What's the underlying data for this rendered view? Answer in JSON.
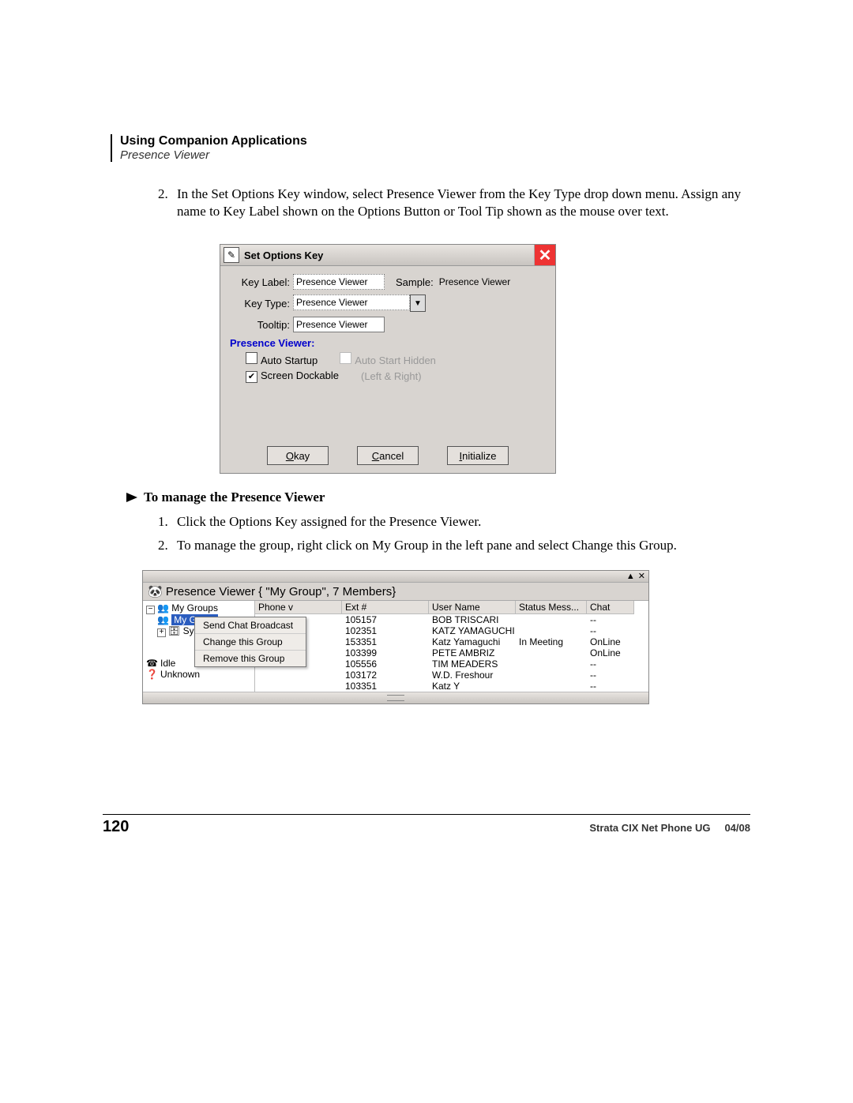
{
  "header": {
    "chapter": "Using Companion Applications",
    "section": "Presence Viewer"
  },
  "intro_step": {
    "num": "2.",
    "text": "In the Set Options Key window, select Presence Viewer from the Key Type drop down menu. Assign any name to Key Label shown on the Options Button or Tool Tip shown as the mouse over text."
  },
  "dialog": {
    "title": "Set Options Key",
    "labels": {
      "key_label": "Key Label:",
      "key_type": "Key Type:",
      "tooltip": "Tooltip:",
      "sample": "Sample:"
    },
    "values": {
      "key_label": "Presence Viewer",
      "key_type": "Presence Viewer",
      "tooltip": "Presence Viewer",
      "sample": "Presence Viewer"
    },
    "section": "Presence Viewer:",
    "checks": {
      "auto_startup": "Auto Startup",
      "auto_start_hidden": "Auto Start Hidden",
      "screen_dockable": "Screen Dockable",
      "screen_dockable_hint": "(Left & Right)"
    },
    "buttons": {
      "ok": "Okay",
      "ok_ul": "O",
      "cancel": "Cancel",
      "cancel_ul": "C",
      "init": "Initialize",
      "init_ul": "I"
    }
  },
  "task": {
    "heading": "To manage the Presence Viewer",
    "steps": [
      {
        "num": "1.",
        "text": "Click the Options Key assigned for the Presence Viewer."
      },
      {
        "num": "2.",
        "text": "To manage the group, right click on My Group in the left pane and select Change this Group."
      }
    ]
  },
  "pv": {
    "title_prefix": "Presence Viewer  ",
    "title_group": "{ \"My Group\", 7 Members}",
    "tree": {
      "root": "My Groups",
      "sel": "My Group",
      "sys": "System"
    },
    "context": [
      "Send Chat Broadcast",
      "Change this Group",
      "Remove this Group"
    ],
    "status_items": [
      "Idle",
      "Unknown"
    ],
    "columns": [
      "Phone  v",
      "Ext #",
      "User Name",
      "Status Mess...",
      "Chat"
    ],
    "rows": [
      {
        "ext": "105157",
        "user": "BOB TRISCARI",
        "status": "",
        "chat": "--"
      },
      {
        "ext": "102351",
        "user": "KATZ YAMAGUCHI",
        "status": "",
        "chat": "--"
      },
      {
        "ext": "153351",
        "user": "Katz Yamaguchi",
        "status": "In Meeting",
        "chat": "OnLine"
      },
      {
        "ext": "103399",
        "user": "PETE AMBRIZ",
        "status": "",
        "chat": "OnLine"
      },
      {
        "ext": "105556",
        "user": "TIM MEADERS",
        "status": "",
        "chat": "--"
      },
      {
        "ext": "103172",
        "user": "W.D. Freshour",
        "status": "",
        "chat": "--"
      },
      {
        "ext": "103351",
        "user": "Katz Y",
        "status": "",
        "chat": "--"
      }
    ]
  },
  "footer": {
    "page": "120",
    "doc": "Strata CIX Net Phone UG",
    "date": "04/08"
  }
}
